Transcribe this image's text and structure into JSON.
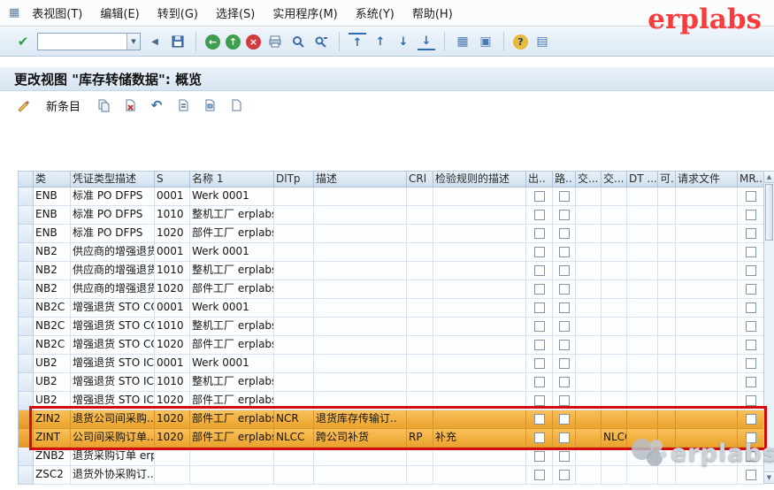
{
  "brand": {
    "top_right": "erplabs",
    "watermark": "erplabs"
  },
  "menubar": {
    "items": [
      "表视图(T)",
      "编辑(E)",
      "转到(G)",
      "选择(S)",
      "实用程序(M)",
      "系统(Y)",
      "帮助(H)"
    ]
  },
  "toolbar": {
    "command_value": ""
  },
  "titlebar": {
    "title": "更改视图 \"库存转储数据\": 概览"
  },
  "app_toolbar": {
    "new_entries_label": "新条目"
  },
  "table": {
    "headers": [
      "类",
      "凭证类型描述",
      "S",
      "名称 1",
      "DlTp",
      "描述",
      "CRl",
      "检验规则的描述",
      "出..",
      "路..",
      "交...",
      "交...",
      "DT ...",
      "可.",
      "请求文件",
      "MR..."
    ],
    "rows": [
      {
        "type": "ENB",
        "doc": "标准 PO DFPS",
        "s": "0001",
        "name": "Werk 0001"
      },
      {
        "type": "ENB",
        "doc": "标准 PO DFPS",
        "s": "1010",
        "name": "整机工厂 erplabs.."
      },
      {
        "type": "ENB",
        "doc": "标准 PO DFPS",
        "s": "1020",
        "name": "部件工厂 erplabs.."
      },
      {
        "type": "NB2",
        "doc": "供应商的增强退货",
        "s": "0001",
        "name": "Werk 0001"
      },
      {
        "type": "NB2",
        "doc": "供应商的增强退货",
        "s": "1010",
        "name": "整机工厂 erplabs.."
      },
      {
        "type": "NB2",
        "doc": "供应商的增强退货",
        "s": "1020",
        "name": "部件工厂 erplabs.."
      },
      {
        "type": "NB2C",
        "doc": "增强退货 STO CC",
        "s": "0001",
        "name": "Werk 0001"
      },
      {
        "type": "NB2C",
        "doc": "增强退货 STO CC",
        "s": "1010",
        "name": "整机工厂 erplabs.."
      },
      {
        "type": "NB2C",
        "doc": "增强退货 STO CC",
        "s": "1020",
        "name": "部件工厂 erplabs.."
      },
      {
        "type": "UB2",
        "doc": "增强退货 STO IC",
        "s": "0001",
        "name": "Werk 0001"
      },
      {
        "type": "UB2",
        "doc": "增强退货 STO IC",
        "s": "1010",
        "name": "整机工厂 erplabs.."
      },
      {
        "type": "UB2",
        "doc": "增强退货 STO IC",
        "s": "1020",
        "name": "部件工厂 erplabs.."
      },
      {
        "type": "ZIN2",
        "doc": "退货公司间采购..",
        "s": "1020",
        "name": "部件工厂 erplabs..",
        "dltp": "NCR",
        "desc": "退货库存传输订..",
        "highlight": true
      },
      {
        "type": "ZINT",
        "doc": "公司间采购订单..",
        "s": "1020",
        "name": "部件工厂 erplabs..",
        "dltp": "NLCC",
        "desc": "跨公司补货",
        "crl": "RP",
        "rule": "补充",
        "x2": "NLCC",
        "highlight": true
      },
      {
        "type": "ZNB2",
        "doc": "退货采购订单 erp.."
      },
      {
        "type": "ZSC2",
        "doc": "退货外协采购订..."
      }
    ]
  },
  "colors": {
    "highlight_top": "#f9c05a",
    "highlight_bottom": "#eba32c",
    "red_border": "#d40b0b",
    "brand_red": "#f93b3b",
    "header_bg": "#e8f0f8"
  }
}
